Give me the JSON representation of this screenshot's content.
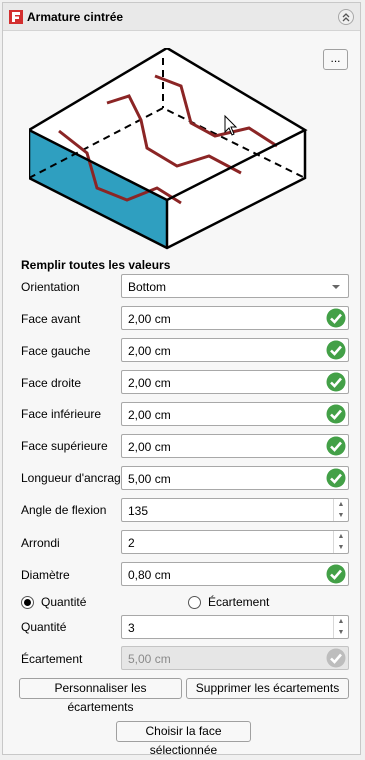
{
  "panel": {
    "title": "Armature cintrée",
    "more_label": "..."
  },
  "section_title": "Remplir toutes les valeurs",
  "orientation": {
    "label": "Orientation",
    "value": "Bottom"
  },
  "fields": {
    "face_avant": {
      "label": "Face avant",
      "value": "2,00 cm"
    },
    "face_gauche": {
      "label": "Face gauche",
      "value": "2,00 cm"
    },
    "face_droite": {
      "label": "Face droite",
      "value": "2,00 cm"
    },
    "face_inferieure": {
      "label": "Face inférieure",
      "value": "2,00 cm"
    },
    "face_superieure": {
      "label": "Face supérieure",
      "value": "2,00 cm"
    },
    "longueur_ancrage": {
      "label": "Longueur d'ancrage",
      "value": "5,00 cm"
    },
    "angle_flexion": {
      "label": "Angle de flexion",
      "value": "135"
    },
    "arrondi": {
      "label": "Arrondi",
      "value": "2"
    },
    "diametre": {
      "label": "Diamètre",
      "value": "0,80 cm"
    },
    "quantite": {
      "label": "Quantité",
      "value": "3"
    },
    "ecartement": {
      "label": "Écartement",
      "value": "5,00 cm"
    }
  },
  "mode": {
    "quantite_label": "Quantité",
    "ecartement_label": "Écartement",
    "selected": "Quantité"
  },
  "buttons": {
    "personnaliser": "Personnaliser les écartements",
    "supprimer": "Supprimer les écartements",
    "choisir": "Choisir la face sélectionnée"
  },
  "colors": {
    "check_green": "#43a047",
    "face_blue": "#2f9fc0",
    "rebar_red": "#8b2525"
  },
  "icons": [
    "freecad-logo-icon",
    "collapse-up-icon",
    "valid-check-icon",
    "mouse-cursor-icon"
  ]
}
